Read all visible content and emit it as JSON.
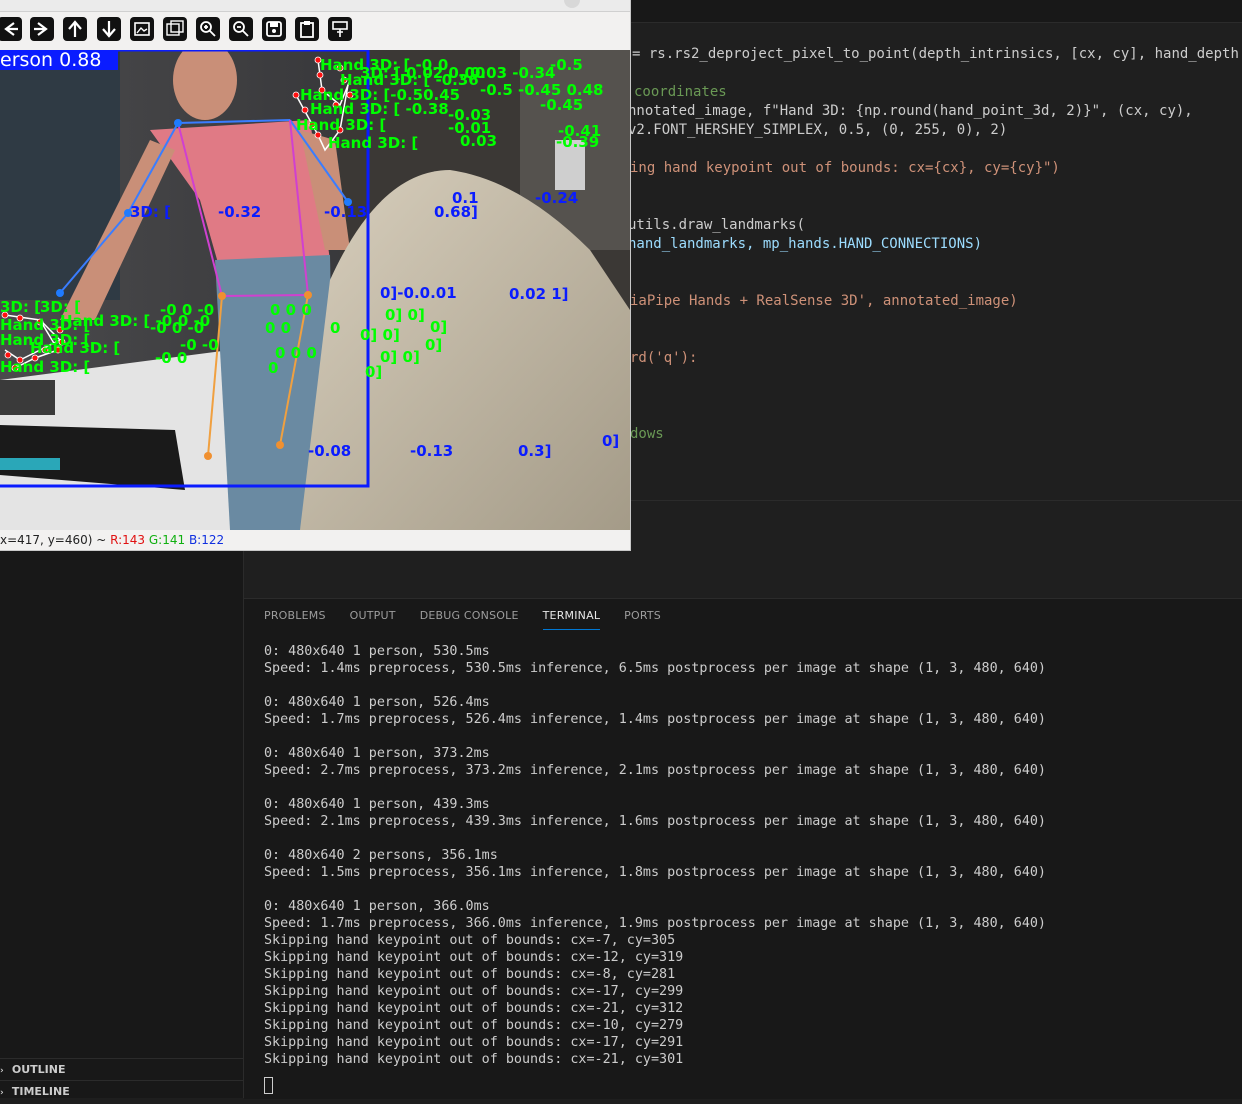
{
  "sidebar": {
    "sections": [
      {
        "label": "OUTLINE"
      },
      {
        "label": "TIMELINE"
      }
    ]
  },
  "editor": {
    "lines": [
      {
        "text": "= rs.rs2_deproject_pixel_to_point(depth_intrinsics, [cx, cy], hand_depth"
      },
      {
        "text": "coordinates"
      },
      {
        "text": "nnotated_image, f\"Hand 3D: {np.round(hand_point_3d, 2)}\", (cx, cy),"
      },
      {
        "text": "v2.FONT_HERSHEY_SIMPLEX, 0.5, (0, 255, 0), 2)"
      },
      {
        "text": "ing hand keypoint out of bounds: cx={cx}, cy={cy}\")"
      },
      {
        "text": "utils.draw_landmarks("
      },
      {
        "text": "hand_landmarks, mp_hands.HAND_CONNECTIONS)"
      },
      {
        "text": "iaPipe Hands + RealSense 3D', annotated_image)"
      },
      {
        "text": "rd('q'):"
      },
      {
        "text": "dows"
      }
    ]
  },
  "panel": {
    "tabs": [
      "PROBLEMS",
      "OUTPUT",
      "DEBUG CONSOLE",
      "TERMINAL",
      "PORTS"
    ],
    "active_tab": "TERMINAL"
  },
  "terminal": {
    "blocks": [
      [
        "0: 480x640 1 person, 530.5ms",
        "Speed: 1.4ms preprocess, 530.5ms inference, 6.5ms postprocess per image at shape (1, 3, 480, 640)"
      ],
      [
        "0: 480x640 1 person, 526.4ms",
        "Speed: 1.7ms preprocess, 526.4ms inference, 1.4ms postprocess per image at shape (1, 3, 480, 640)"
      ],
      [
        "0: 480x640 1 person, 373.2ms",
        "Speed: 2.7ms preprocess, 373.2ms inference, 2.1ms postprocess per image at shape (1, 3, 480, 640)"
      ],
      [
        "0: 480x640 1 person, 439.3ms",
        "Speed: 2.1ms preprocess, 439.3ms inference, 1.6ms postprocess per image at shape (1, 3, 480, 640)"
      ],
      [
        "0: 480x640 2 persons, 356.1ms",
        "Speed: 1.5ms preprocess, 356.1ms inference, 1.8ms postprocess per image at shape (1, 3, 480, 640)"
      ],
      [
        "0: 480x640 1 person, 366.0ms",
        "Speed: 1.7ms preprocess, 366.0ms inference, 1.9ms postprocess per image at shape (1, 3, 480, 640)",
        "Skipping hand keypoint out of bounds: cx=-7, cy=305",
        "Skipping hand keypoint out of bounds: cx=-12, cy=319",
        "Skipping hand keypoint out of bounds: cx=-8, cy=281",
        "Skipping hand keypoint out of bounds: cx=-17, cy=299",
        "Skipping hand keypoint out of bounds: cx=-21, cy=312",
        "Skipping hand keypoint out of bounds: cx=-10, cy=279",
        "Skipping hand keypoint out of bounds: cx=-17, cy=291",
        "Skipping hand keypoint out of bounds: cx=-21, cy=301"
      ]
    ]
  },
  "cv_window": {
    "toolbar": [
      {
        "icon": "arrow-left-icon"
      },
      {
        "icon": "arrow-right-icon"
      },
      {
        "icon": "arrow-up-icon"
      },
      {
        "icon": "arrow-down-icon"
      },
      {
        "icon": "image-icon"
      },
      {
        "icon": "images-icon"
      },
      {
        "icon": "zoom-in-icon"
      },
      {
        "icon": "zoom-out-icon"
      },
      {
        "icon": "save-icon"
      },
      {
        "icon": "clipboard-icon"
      },
      {
        "icon": "properties-icon"
      }
    ],
    "detection_label": "erson 0.88",
    "overlay_labels": [
      {
        "text": "3D: [",
        "color": "blue"
      },
      {
        "text": "-0.32",
        "color": "blue"
      },
      {
        "text": "-0.13",
        "color": "blue"
      },
      {
        "text": "0.68]",
        "color": "blue"
      },
      {
        "text": "-0.24",
        "color": "blue"
      },
      {
        "text": "0.1",
        "color": "blue"
      },
      {
        "text": "0]-0.0.01",
        "color": "blue"
      },
      {
        "text": "0.02 1]",
        "color": "blue"
      },
      {
        "text": "-0.08",
        "color": "blue"
      },
      {
        "text": "-0.13",
        "color": "blue"
      },
      {
        "text": "0.3]",
        "color": "blue"
      },
      {
        "text": "0]",
        "color": "blue"
      },
      {
        "text": "Hand 3D: [",
        "color": "green"
      },
      {
        "text": "-0.03",
        "color": "green"
      },
      {
        "text": "-0.41",
        "color": "green"
      },
      {
        "text": "-0.39",
        "color": "green"
      }
    ],
    "status": {
      "coords": "x=417, y=460) ~ ",
      "r": "R:143",
      "g": "G:141",
      "b": "B:122"
    },
    "colors": {
      "bbox": "#0a1cff",
      "keypoint": "#1f7bff",
      "hand_text": "#00ff00",
      "hand_point": "#ff1010"
    }
  }
}
